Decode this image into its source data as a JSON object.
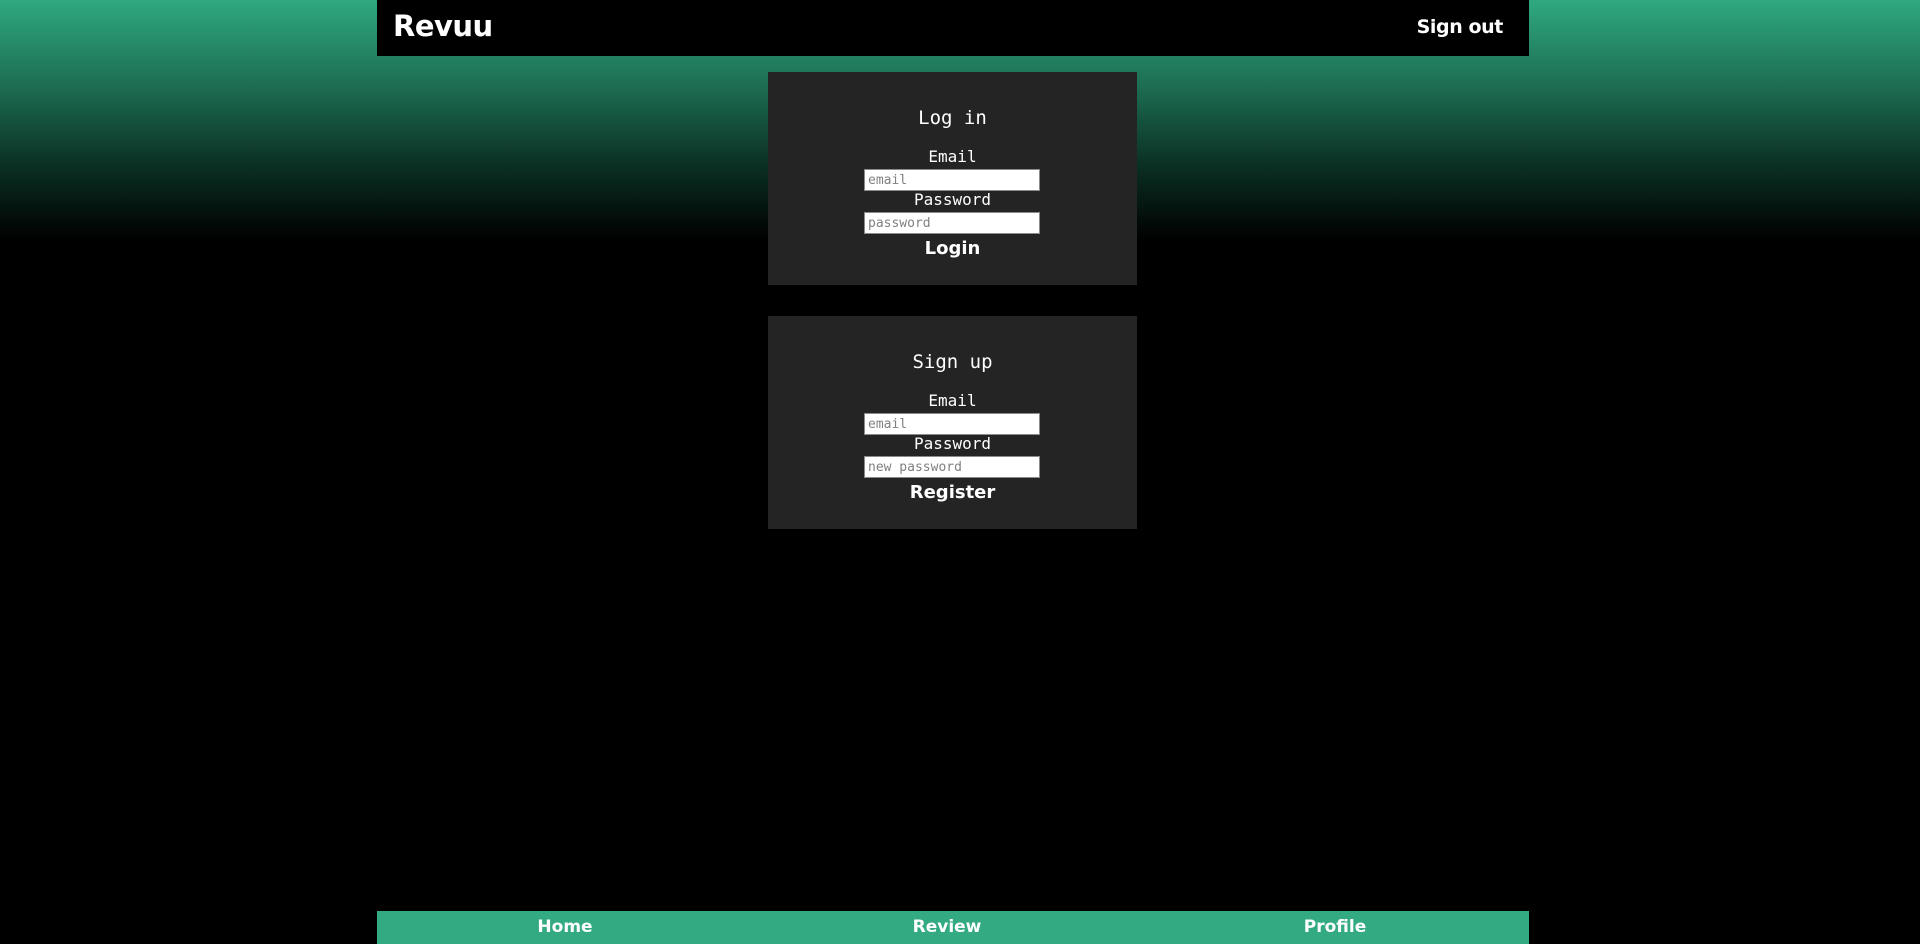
{
  "header": {
    "brand": "Revuu",
    "sign_out_label": "Sign out"
  },
  "login": {
    "title": "Log in",
    "email_label": "Email",
    "email_placeholder": "email",
    "password_label": "Password",
    "password_placeholder": "password",
    "submit_label": "Login"
  },
  "signup": {
    "title": "Sign up",
    "email_label": "Email",
    "email_placeholder": "email",
    "password_label": "Password",
    "password_placeholder": "new password",
    "submit_label": "Register"
  },
  "bottom_nav": {
    "items": [
      {
        "label": "Home"
      },
      {
        "label": "Review"
      },
      {
        "label": "Profile"
      }
    ]
  },
  "colors": {
    "accent": "#33aa82",
    "card_background": "#242424",
    "page_background": "#000000"
  }
}
